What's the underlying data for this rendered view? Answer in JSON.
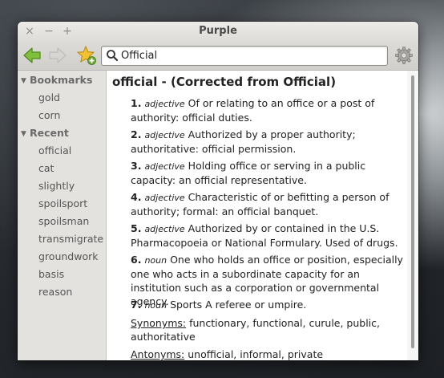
{
  "window": {
    "title": "Purple"
  },
  "window_controls": {
    "close": "×",
    "minimize": "−",
    "maximize": "+"
  },
  "toolbar": {
    "back_icon": "back-arrow-icon",
    "forward_icon": "forward-arrow-icon",
    "bookmark_icon": "add-bookmark-star-icon",
    "settings_icon": "gear-icon",
    "search_value": "Official",
    "colors": {
      "back_arrow": "#7fbf3a",
      "star": "#f2c230"
    }
  },
  "sidebar": {
    "bookmarks_label": "Bookmarks",
    "bookmarks": [
      "gold",
      "corn"
    ],
    "recent_label": "Recent",
    "recent": [
      "official",
      "cat",
      "slightly",
      "spoilsport",
      "spoilsman",
      "transmigrate",
      "groundwork",
      "basis",
      "reason"
    ]
  },
  "entry": {
    "headword": "official - (Corrected from Official)",
    "definitions": [
      {
        "num": "1.",
        "pos": "adjective",
        "text": "Of or relating to an office or a post of authority:  official duties."
      },
      {
        "num": "2.",
        "pos": "adjective",
        "text": "Authorized by a proper authority; authoritative:  official permission."
      },
      {
        "num": "3.",
        "pos": "adjective",
        "text": "Holding office or serving in a public capacity:  an official representative."
      },
      {
        "num": "4.",
        "pos": "adjective",
        "text": "Characteristic of or befitting a person of authority; formal:  an official banquet."
      },
      {
        "num": "5.",
        "pos": "adjective",
        "text": "Authorized by or contained in the U.S. Pharmacopoeia or National Formulary. Used of drugs."
      },
      {
        "num": "6.",
        "pos": "noun",
        "text": "One who holds an office or position, especially one who acts in a subordinate capacity for an institution such as a corporation or governmental agency."
      },
      {
        "num": "7.",
        "pos": "noun",
        "text": "Sports   A referee or umpire."
      }
    ],
    "synonyms_label": "Synonyms:",
    "synonyms": "functionary, functional, curule, public, authoritative",
    "antonyms_label": "Antonyms:",
    "antonyms": "unofficial, informal, private"
  }
}
